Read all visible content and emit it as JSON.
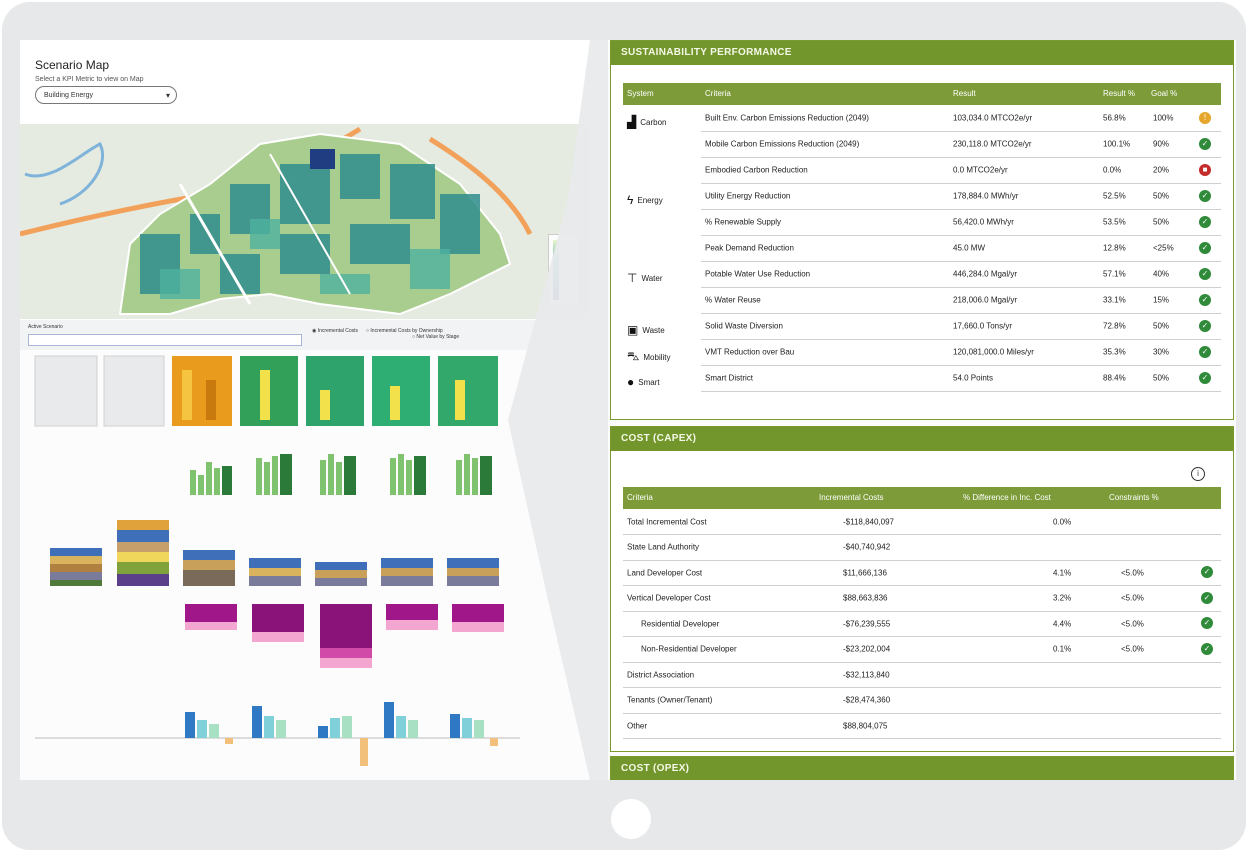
{
  "scenario": {
    "title": "Scenario Map",
    "subtitle": "Select a KPI Metric to view on Map",
    "dropdown_value": "Building Energy"
  },
  "analytics": {
    "input_label": "Active Scenario",
    "radio_options": [
      "Incremental Costs",
      "Incremental Costs by Ownership",
      "Net Value by Stage"
    ]
  },
  "colors": {
    "panel_header": "#73962c",
    "table_header": "#7d9b39",
    "status_ok": "#2f8a3a",
    "status_warn": "#e5a62b",
    "status_bad": "#c42c2c"
  },
  "sustainability": {
    "title": "SUSTAINABILITY PERFORMANCE",
    "headers": [
      "System",
      "Criteria",
      "Result",
      "Result %",
      "Goal %"
    ],
    "categories": [
      {
        "label": "Carbon",
        "icon": "factory-icon"
      },
      {
        "label": "Energy",
        "icon": "lightning-icon"
      },
      {
        "label": "Water",
        "icon": "faucet-icon"
      },
      {
        "label": "Waste",
        "icon": "bin-icon"
      },
      {
        "label": "Mobility",
        "icon": "car-icon"
      },
      {
        "label": "Smart",
        "icon": "bulb-icon"
      }
    ],
    "rows": [
      {
        "criteria": "Built Env. Carbon Emissions Reduction (2049)",
        "result": "103,034.0 MTCO2e/yr",
        "pct": "56.8%",
        "goal": "100%",
        "status": "warn"
      },
      {
        "criteria": "Mobile Carbon Emissions Reduction (2049)",
        "result": "230,118.0 MTCO2e/yr",
        "pct": "100.1%",
        "goal": "90%",
        "status": "ok"
      },
      {
        "criteria": "Embodied Carbon Reduction",
        "result": "0.0 MTCO2e/yr",
        "pct": "0.0%",
        "goal": "20%",
        "status": "bad"
      },
      {
        "criteria": "Utility Energy Reduction",
        "result": "178,884.0 MWh/yr",
        "pct": "52.5%",
        "goal": "50%",
        "status": "ok"
      },
      {
        "criteria": "% Renewable Supply",
        "result": "56,420.0 MWh/yr",
        "pct": "53.5%",
        "goal": "50%",
        "status": "ok"
      },
      {
        "criteria": "Peak Demand Reduction",
        "result": "45.0 MW",
        "pct": "12.8%",
        "goal": "<25%",
        "status": "ok"
      },
      {
        "criteria": "Potable Water Use Reduction",
        "result": "446,284.0 Mgal/yr",
        "pct": "57.1%",
        "goal": "40%",
        "status": "ok"
      },
      {
        "criteria": "% Water Reuse",
        "result": "218,006.0 Mgal/yr",
        "pct": "33.1%",
        "goal": "15%",
        "status": "ok"
      },
      {
        "criteria": "Solid Waste Diversion",
        "result": "17,660.0 Tons/yr",
        "pct": "72.8%",
        "goal": "50%",
        "status": "ok"
      },
      {
        "criteria": "VMT Reduction over Bau",
        "result": "120,081,000.0 Miles/yr",
        "pct": "35.3%",
        "goal": "30%",
        "status": "ok"
      },
      {
        "criteria": "Smart District",
        "result": "54.0 Points",
        "pct": "88.4%",
        "goal": "50%",
        "status": "ok"
      }
    ]
  },
  "capex": {
    "title": "COST (CAPEX)",
    "headers": [
      "Criteria",
      "Incremental Costs",
      "% Difference in Inc. Cost",
      "Constraints %",
      ""
    ],
    "rows": [
      {
        "criteria": "Total Incremental Cost",
        "cost": "-$118,840,097",
        "diff": "0.0%",
        "constraint": "",
        "status": ""
      },
      {
        "criteria": "State Land Authority",
        "cost": "-$40,740,942",
        "diff": "",
        "constraint": "",
        "status": ""
      },
      {
        "criteria": "Land Developer Cost",
        "cost": "$11,666,136",
        "diff": "4.1%",
        "constraint": "<5.0%",
        "status": "ok"
      },
      {
        "criteria": "Vertical Developer Cost",
        "cost": "$88,663,836",
        "diff": "3.2%",
        "constraint": "<5.0%",
        "status": "ok"
      },
      {
        "criteria": "Residential Developer",
        "cost": "-$76,239,555",
        "diff": "4.4%",
        "constraint": "<5.0%",
        "status": "ok",
        "indent": true
      },
      {
        "criteria": "Non-Residential Developer",
        "cost": "-$23,202,004",
        "diff": "0.1%",
        "constraint": "<5.0%",
        "status": "ok",
        "indent": true
      },
      {
        "criteria": "District Association",
        "cost": "-$32,113,840",
        "diff": "",
        "constraint": "",
        "status": ""
      },
      {
        "criteria": "Tenants (Owner/Tenant)",
        "cost": "-$28,474,360",
        "diff": "",
        "constraint": "",
        "status": ""
      },
      {
        "criteria": "Other",
        "cost": "$88,804,075",
        "diff": "",
        "constraint": "",
        "status": ""
      }
    ]
  },
  "opex": {
    "title": "COST (OPEX)"
  }
}
